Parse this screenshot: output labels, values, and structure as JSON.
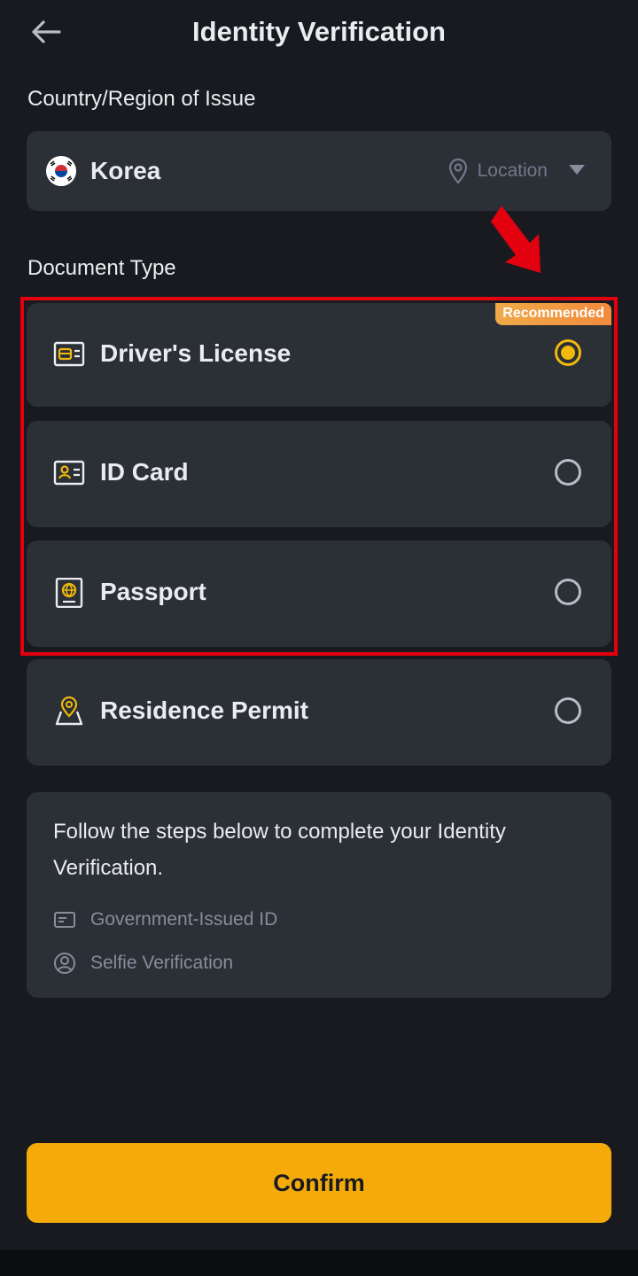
{
  "header": {
    "title": "Identity Verification"
  },
  "country_section": {
    "label": "Country/Region of Issue",
    "country": "Korea",
    "location_label": "Location"
  },
  "document_section": {
    "label": "Document Type",
    "badge": "Recommended",
    "options": [
      {
        "label": "Driver's License",
        "selected": true,
        "icon": "drivers-license-icon"
      },
      {
        "label": "ID Card",
        "selected": false,
        "icon": "id-card-icon"
      },
      {
        "label": "Passport",
        "selected": false,
        "icon": "passport-icon"
      },
      {
        "label": "Residence Permit",
        "selected": false,
        "icon": "residence-permit-icon"
      }
    ]
  },
  "info": {
    "text": "Follow the steps below to complete your Identity Verification.",
    "steps": [
      {
        "label": "Government-Issued ID",
        "icon": "id-card-outline-icon"
      },
      {
        "label": "Selfie Verification",
        "icon": "user-circle-icon"
      }
    ]
  },
  "footer": {
    "confirm_label": "Confirm"
  },
  "colors": {
    "background": "#181a20",
    "card": "#2b2f36",
    "accent": "#f0b90b",
    "annotation": "#e3000f"
  }
}
